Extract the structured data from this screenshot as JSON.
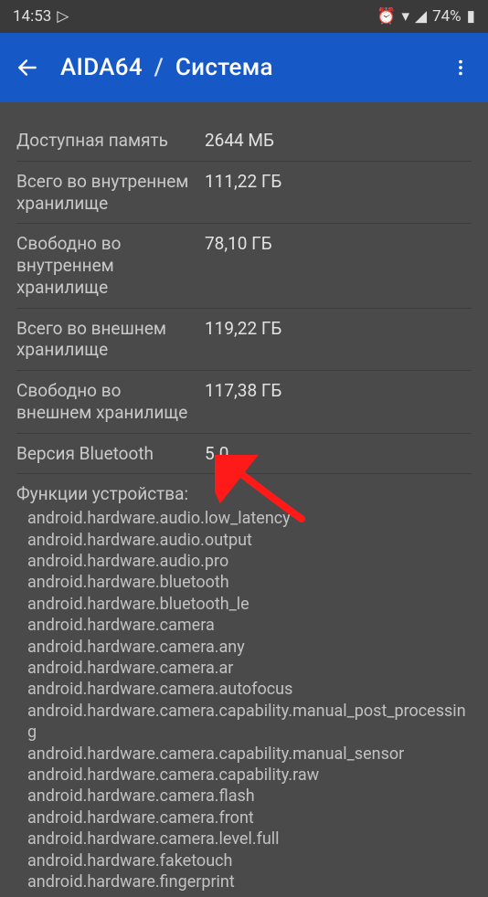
{
  "statusbar": {
    "time": "14:53",
    "play_icon": "▷",
    "alarm_icon": "⏰",
    "wifi_icon": "▾",
    "signal_icon": "◢",
    "battery_text": "74%",
    "battery_icon": "▮"
  },
  "appbar": {
    "back": "←",
    "app_name": "AIDA64",
    "slash": "/",
    "page": "Система",
    "menu": "⋮"
  },
  "rows": {
    "mem": {
      "label": "Доступная память",
      "value": "2644 МБ"
    },
    "int_total": {
      "label": "Всего во внутреннем хранилище",
      "value": "111,22 ГБ"
    },
    "int_free": {
      "label": "Свободно во внутреннем хранилище",
      "value": "78,10 ГБ"
    },
    "ext_total": {
      "label": "Всего во внешнем хранилище",
      "value": "119,22 ГБ"
    },
    "ext_free": {
      "label": "Свободно во внешнем хранилище",
      "value": "117,38 ГБ"
    },
    "bt": {
      "label": "Версия Bluetooth",
      "value": "5.0"
    }
  },
  "features_header": "Функции устройства:",
  "features": [
    "android.hardware.audio.low_latency",
    "android.hardware.audio.output",
    "android.hardware.audio.pro",
    "android.hardware.bluetooth",
    "android.hardware.bluetooth_le",
    "android.hardware.camera",
    "android.hardware.camera.any",
    "android.hardware.camera.ar",
    "android.hardware.camera.autofocus",
    "android.hardware.camera.capability.manual_post_processing",
    "android.hardware.camera.capability.manual_sensor",
    "android.hardware.camera.capability.raw",
    "android.hardware.camera.flash",
    "android.hardware.camera.front",
    "android.hardware.camera.level.full",
    "android.hardware.faketouch",
    "android.hardware.fingerprint"
  ]
}
